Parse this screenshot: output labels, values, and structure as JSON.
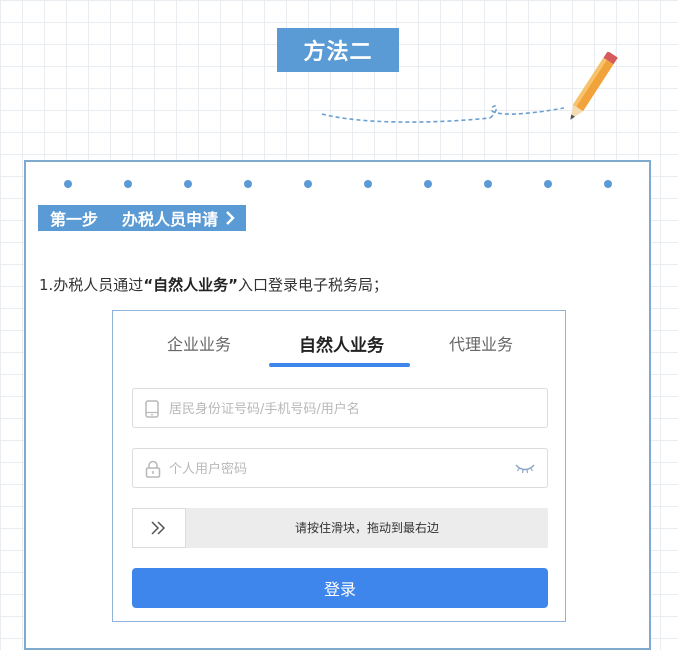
{
  "header": {
    "title": "方法二"
  },
  "step": {
    "number_label": "第一步",
    "title": "办税人员申请",
    "chevron_icon": "chevron-right-icon"
  },
  "instruction": {
    "prefix": "1.办税人员通过",
    "highlight": "“自然人业务”",
    "suffix": "入口登录电子税务局；"
  },
  "login": {
    "tabs": [
      {
        "label": "企业业务",
        "active": false
      },
      {
        "label": "自然人业务",
        "active": true
      },
      {
        "label": "代理业务",
        "active": false
      }
    ],
    "username": {
      "placeholder": "居民身份证号码/手机号码/用户名",
      "value": "",
      "icon": "phone-icon"
    },
    "password": {
      "placeholder": "个人用户密码",
      "value": "",
      "icon": "lock-icon",
      "toggle_icon": "eye-closed-icon"
    },
    "slider": {
      "text": "请按住滑块，拖动到最右边",
      "handle_icon": "double-chevron-right-icon"
    },
    "submit_label": "登录"
  },
  "colors": {
    "accent": "#5b9bd5",
    "button": "#3f86ec",
    "grid": "#e9edf2",
    "border": "#7fa9cf"
  }
}
